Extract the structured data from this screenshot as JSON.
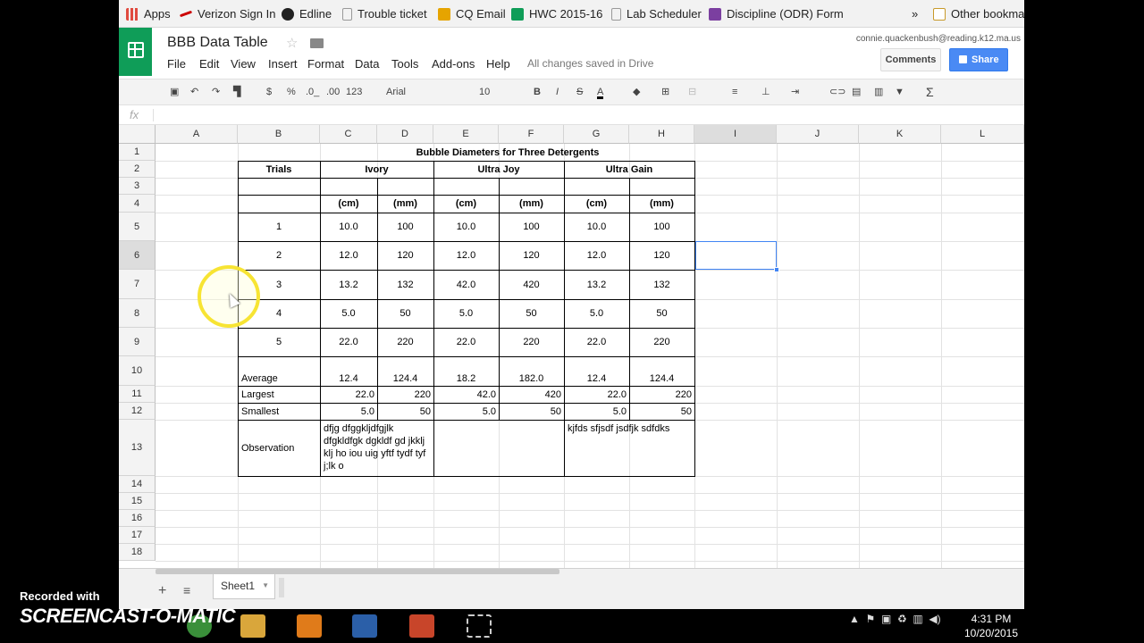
{
  "bookmarks": [
    {
      "label": "Apps",
      "color": "#e04a3f"
    },
    {
      "label": "Verizon Sign In",
      "color": "#cc0000"
    },
    {
      "label": "Edline",
      "color": "#222222"
    },
    {
      "label": "Trouble ticket",
      "color": "#999999"
    },
    {
      "label": "CQ Email",
      "color": "#e6a400"
    },
    {
      "label": "HWC 2015-16",
      "color": "#0f9d58"
    },
    {
      "label": "Lab Scheduler",
      "color": "#999999"
    },
    {
      "label": "Discipline (ODR) Form",
      "color": "#7b3fa0"
    },
    {
      "label": "»",
      "color": ""
    },
    {
      "label": "Other bookmarks",
      "color": "#e8b23a"
    }
  ],
  "doc": {
    "title": "BBB Data Table",
    "user": "connie.quackenbush@reading.k12.ma.us",
    "saved_status": "All changes saved in Drive",
    "comments_label": "Comments",
    "share_label": "Share"
  },
  "menus": [
    "File",
    "Edit",
    "View",
    "Insert",
    "Format",
    "Data",
    "Tools",
    "Add-ons",
    "Help"
  ],
  "toolbar": {
    "currency": "$",
    "percent": "%",
    "dec_decrease": ".0_",
    "dec_increase": ".00",
    "number_format": "123",
    "font": "Arial",
    "font_size": "10",
    "bold": "B",
    "italic": "I",
    "strike": "S",
    "text_color": "A",
    "sum": "Σ",
    "fx": "fx"
  },
  "columns": [
    "A",
    "B",
    "C",
    "D",
    "E",
    "F",
    "G",
    "H",
    "I",
    "J",
    "K",
    "L"
  ],
  "rows": [
    "1",
    "2",
    "3",
    "4",
    "5",
    "6",
    "7",
    "8",
    "9",
    "10",
    "11",
    "12",
    "13",
    "14",
    "15",
    "16",
    "17",
    "18"
  ],
  "sheet": {
    "title": "Bubble Diameters for Three Detergents",
    "trials_header": "Trials",
    "detergents": [
      "Ivory",
      "Ultra Joy",
      "Ultra Gain"
    ],
    "units": [
      "(cm)",
      "(mm)",
      "(cm)",
      "(mm)",
      "(cm)",
      "(mm)"
    ],
    "trials": [
      {
        "n": "1",
        "values": [
          "10.0",
          "100",
          "10.0",
          "100",
          "10.0",
          "100"
        ]
      },
      {
        "n": "2",
        "values": [
          "12.0",
          "120",
          "12.0",
          "120",
          "12.0",
          "120"
        ]
      },
      {
        "n": "3",
        "values": [
          "13.2",
          "132",
          "42.0",
          "420",
          "13.2",
          "132"
        ]
      },
      {
        "n": "4",
        "values": [
          "5.0",
          "50",
          "5.0",
          "50",
          "5.0",
          "50"
        ]
      },
      {
        "n": "5",
        "values": [
          "22.0",
          "220",
          "22.0",
          "220",
          "22.0",
          "220"
        ]
      }
    ],
    "average": {
      "label": "Average",
      "values": [
        "12.4",
        "124.4",
        "18.2",
        "182.0",
        "12.4",
        "124.4"
      ]
    },
    "largest": {
      "label": "Largest",
      "values": [
        "22.0",
        "220",
        "42.0",
        "420",
        "22.0",
        "220"
      ]
    },
    "smallest": {
      "label": "Smallest",
      "values": [
        "5.0",
        "50",
        "5.0",
        "50",
        "5.0",
        "50"
      ]
    },
    "observation": {
      "label": "Observation",
      "ivory": "dfjg dfggkljdfgjlk dfgkldfgk dgkldf gd jkklj klj ho iou uig yftf tydf tyf j;lk o",
      "ultra_joy": "",
      "ultra_gain": "kjfds sfjsdf jsdfjk sdfdks"
    }
  },
  "sheet_tab": "Sheet1",
  "taskbar": {
    "time": "4:31 PM",
    "date": "10/20/2015",
    "app_colors": [
      "#1a6fbf",
      "#d9a63b",
      "#e07b1a",
      "#2b5fa8",
      "#c8452a",
      "#555555"
    ]
  },
  "watermark": {
    "recorded_with": "Recorded with",
    "logo": "SCREENCAST-O-MATIC"
  }
}
